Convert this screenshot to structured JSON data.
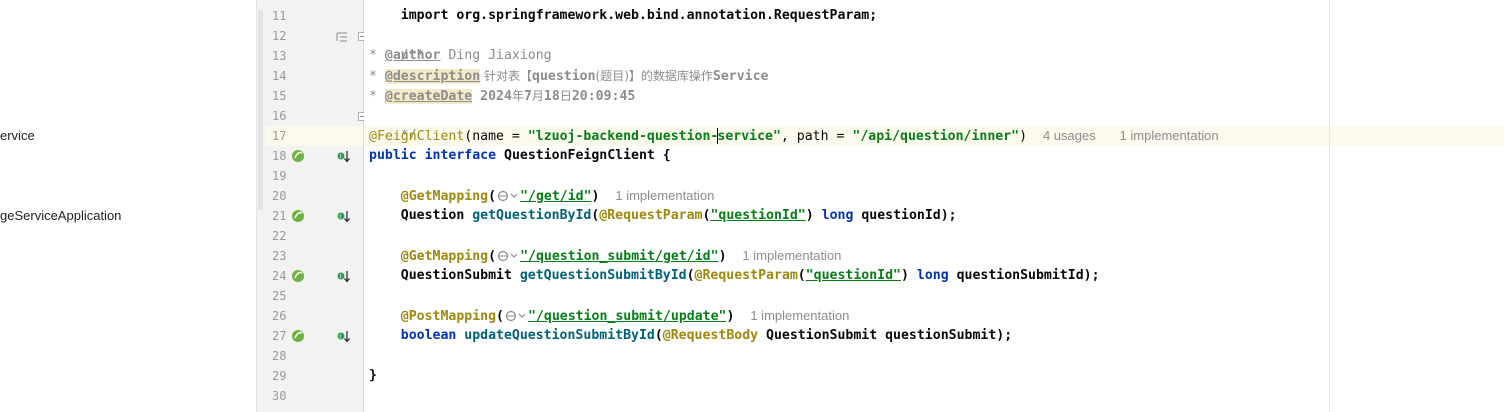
{
  "project_tree": {
    "items": [
      {
        "label": "ervice"
      },
      {
        "label": "geServiceApplication"
      }
    ]
  },
  "gutter": {
    "line_numbers": [
      "11",
      "12",
      "13",
      "14",
      "15",
      "16",
      "17",
      "18",
      "19",
      "20",
      "21",
      "22",
      "23",
      "24",
      "25",
      "26",
      "27",
      "28",
      "29",
      "30"
    ]
  },
  "code": {
    "l10_partial": "import org.springframework.web.bind.annotation.RequestParam;",
    "l12": "/**",
    "l13_prefix": "* ",
    "l13_tag": "@author",
    "l13_text": " Ding Jiaxiong",
    "l14_prefix": "* ",
    "l14_tag": "@description",
    "l14_cjk1": " 针对表【",
    "l14_mid": "question",
    "l14_cjk2": "(题目)】的数据库操作",
    "l14_end": "Service",
    "l15_prefix": "* ",
    "l15_tag": "@createDate",
    "l15_date_a": " 2024",
    "l15_cjk_year": "年",
    "l15_date_b": "7",
    "l15_cjk_month": "月",
    "l15_date_c": "18",
    "l15_cjk_day": "日",
    "l15_date_d": "20:09:45",
    "l16": "*/",
    "l17_ann": "@FeignClient",
    "l17_a": "(name = ",
    "l17_str_a": "\"lzuoj-backend-question-",
    "l17_str_b": "service\"",
    "l17_b": ", path = ",
    "l17_str_c": "\"/api/question/inner\"",
    "l17_c": ")",
    "l17_hint_usages": "4 usages",
    "l17_hint_impl": "1 implementation",
    "l18_kw1": "public",
    "l18_kw2": "interface",
    "l18_name": " QuestionFeignClient {",
    "l20_ann": "@GetMapping",
    "l20_open": "(",
    "l20_str": "\"/get/id\"",
    "l20_close": ")",
    "l20_hint": "1 implementation",
    "l21_type": "Question ",
    "l21_meth": "getQuestionById",
    "l21_open": "(",
    "l21_ann": "@RequestParam",
    "l21_p": "(",
    "l21_str": "\"questionId\"",
    "l21_p2": ") ",
    "l21_kw": "long",
    "l21_end": " questionId);",
    "l23_ann": "@GetMapping",
    "l23_open": "(",
    "l23_str": "\"/question_submit/get/id\"",
    "l23_close": ")",
    "l23_hint": "1 implementation",
    "l24_type": "QuestionSubmit ",
    "l24_meth": "getQuestionSubmitById",
    "l24_open": "(",
    "l24_ann": "@RequestParam",
    "l24_p": "(",
    "l24_str": "\"questionId\"",
    "l24_p2": ") ",
    "l24_kw": "long",
    "l24_end": " questionSubmitId);",
    "l26_ann": "@PostMapping",
    "l26_open": "(",
    "l26_str": "\"/question_submit/update\"",
    "l26_close": ")",
    "l26_hint": "1 implementation",
    "l27_kw": "boolean",
    "l27_meth": " updateQuestionSubmitById",
    "l27_open": "(",
    "l27_ann": "@RequestBody",
    "l27_end": " QuestionSubmit questionSubmit);",
    "l29": "}"
  },
  "icons": {
    "impl_marker": "implemented-method-icon",
    "spring_marker": "spring-bean-icon",
    "globe": "web-endpoint-icon",
    "fold": "fold-icon"
  },
  "colors": {
    "keyword": "#0033b3",
    "annotation": "#9e880d",
    "string": "#067d17",
    "comment": "#8c8c8c",
    "method": "#00627a",
    "current_line": "#fcfaed"
  }
}
